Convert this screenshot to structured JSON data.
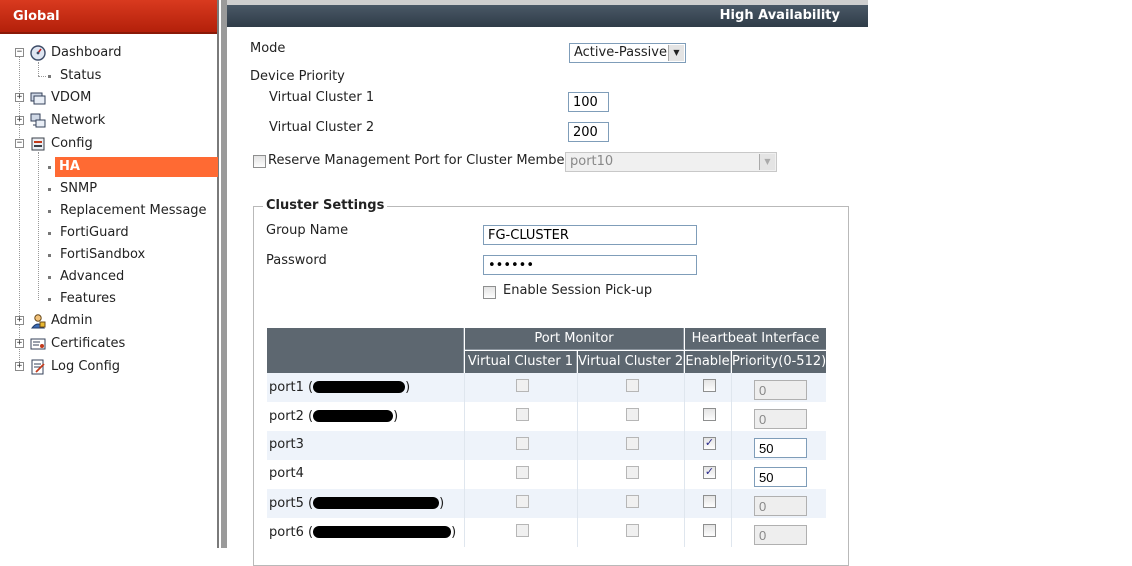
{
  "sidebar": {
    "header": "Global",
    "items": [
      {
        "label": "Dashboard",
        "icon": "dashboard-icon"
      },
      {
        "label": "Status"
      },
      {
        "label": "VDOM",
        "icon": "vdom-icon"
      },
      {
        "label": "Network",
        "icon": "network-icon"
      },
      {
        "label": "Config",
        "icon": "config-icon"
      },
      {
        "label": "HA"
      },
      {
        "label": "SNMP"
      },
      {
        "label": "Replacement Message"
      },
      {
        "label": "FortiGuard"
      },
      {
        "label": "FortiSandbox"
      },
      {
        "label": "Advanced"
      },
      {
        "label": "Features"
      },
      {
        "label": "Admin",
        "icon": "admin-icon"
      },
      {
        "label": "Certificates",
        "icon": "certificates-icon"
      },
      {
        "label": "Log Config",
        "icon": "log-config-icon"
      }
    ],
    "selected": "HA",
    "accent": "#ff6a33"
  },
  "page": {
    "title": "High Availability",
    "mode_label": "Mode",
    "mode_value": "Active-Passive",
    "device_priority_label": "Device Priority",
    "vc1_label": "Virtual Cluster 1",
    "vc1_value": "100",
    "vc2_label": "Virtual Cluster 2",
    "vc2_value": "200",
    "reserve_label": "Reserve Management Port for Cluster Member",
    "reserve_port": "port10"
  },
  "cluster": {
    "legend": "Cluster Settings",
    "group_name_label": "Group Name",
    "group_name_value": "FG-CLUSTER",
    "password_label": "Password",
    "password_value": "••••••",
    "session_pickup_label": "Enable Session Pick-up"
  },
  "table": {
    "port_monitor": "Port Monitor",
    "heartbeat": "Heartbeat Interface",
    "col_vc1": "Virtual Cluster 1",
    "col_vc2": "Virtual Cluster 2",
    "col_enable": "Enable",
    "col_priority": "Priority(0-512)",
    "rows": [
      {
        "port": "port1 (",
        "suffix": ")",
        "redacted": true,
        "enable": false,
        "priority": "0"
      },
      {
        "port": "port2 (",
        "suffix": ")",
        "redacted": true,
        "enable": false,
        "priority": "0"
      },
      {
        "port": "port3",
        "suffix": "",
        "redacted": false,
        "enable": true,
        "priority": "50"
      },
      {
        "port": "port4",
        "suffix": "",
        "redacted": false,
        "enable": true,
        "priority": "50"
      },
      {
        "port": "port5 (",
        "suffix": ")",
        "redacted": true,
        "enable": false,
        "priority": "0"
      },
      {
        "port": "port6 (",
        "suffix": ")",
        "redacted": true,
        "enable": false,
        "priority": "0"
      }
    ]
  }
}
